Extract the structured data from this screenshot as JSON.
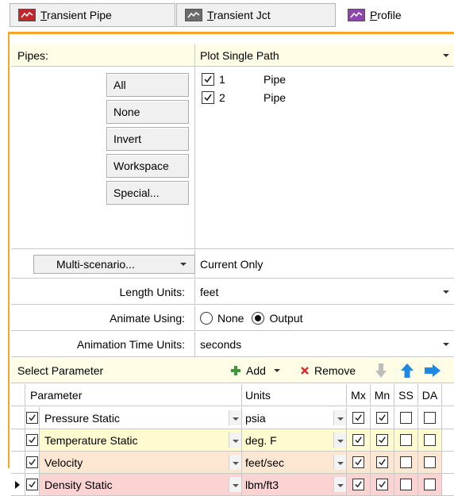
{
  "tabs": [
    {
      "label_u": "T",
      "label_rest": "ransient Pipe",
      "icon": "red-graph-icon",
      "color": "#c0272d"
    },
    {
      "label_u": "T",
      "label_rest": "ransient Jct",
      "icon": "gray-graph-icon",
      "color": "#6b6b6b"
    },
    {
      "label_u": "P",
      "label_rest": "rofile",
      "icon": "purple-graph-icon",
      "color": "#8e44ad"
    }
  ],
  "pipes": {
    "label": "Pipes:",
    "mode": "Plot Single Path",
    "buttons": [
      "All",
      "None",
      "Invert",
      "Workspace",
      "Special..."
    ],
    "items": [
      {
        "number": "1",
        "name": "Pipe",
        "checked": true
      },
      {
        "number": "2",
        "name": "Pipe",
        "checked": true
      }
    ]
  },
  "multi_scenario": {
    "button": "Multi-scenario...",
    "value": "Current Only"
  },
  "length_units": {
    "label": "Length Units:",
    "value": "feet"
  },
  "animate_using": {
    "label": "Animate Using:",
    "options": [
      "None",
      "Output"
    ],
    "selected": "Output"
  },
  "animation_time_units": {
    "label": "Animation Time Units:",
    "value": "seconds"
  },
  "param_toolbar": {
    "title": "Select Parameter",
    "add": "Add",
    "remove": "Remove"
  },
  "grid": {
    "headers": {
      "parameter": "Parameter",
      "units": "Units",
      "mx": "Mx",
      "mn": "Mn",
      "ss": "SS",
      "da": "DA"
    },
    "rows": [
      {
        "parameter": "Pressure Static",
        "units": "psia",
        "selected": true,
        "mx": true,
        "mn": true,
        "ss": false,
        "da": false,
        "color": "#ffffff"
      },
      {
        "parameter": "Temperature Static",
        "units": "deg. F",
        "selected": true,
        "mx": true,
        "mn": true,
        "ss": false,
        "da": false,
        "color": "#fffbd0"
      },
      {
        "parameter": "Velocity",
        "units": "feet/sec",
        "selected": true,
        "mx": true,
        "mn": true,
        "ss": false,
        "da": false,
        "color": "#fde6d2"
      },
      {
        "parameter": "Density Static",
        "units": "lbm/ft3",
        "selected": true,
        "mx": true,
        "mn": true,
        "ss": false,
        "da": false,
        "color": "#fbd3d3"
      }
    ]
  }
}
